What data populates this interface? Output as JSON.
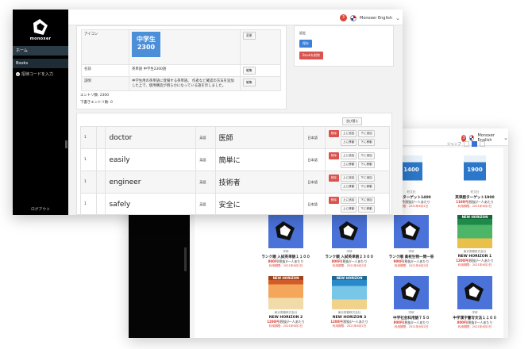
{
  "header": {
    "notification_count": "3",
    "user_name": "Monoxer English"
  },
  "sidebar": {
    "logo_text": "monoxer",
    "items": [
      {
        "label": "ホーム"
      },
      {
        "label": "Books"
      },
      {
        "label": "招待コードを入力"
      }
    ],
    "logout": "ログアウト"
  },
  "detail": {
    "icon_label": "アイコン",
    "icon_line1": "中学生",
    "icon_line2": "2300",
    "change_button": "変更",
    "name_label": "名前",
    "name_value": "英単語 中学生2300語",
    "edit_button": "編集",
    "desc_label": "説明",
    "desc_value": "中学生用の英単語に登場する英単語。 作者など確認の方法を追加した上で、使用構造が明らかになっている語を示しました。",
    "entries_count": "エントリ数: 2300",
    "entries_limit": "下書きエントリ数: 0"
  },
  "side_card": {
    "label": "設定",
    "save_button": "保存",
    "delete_button": "Bookを削除"
  },
  "words_table": {
    "reorder_button": "並び替え",
    "rows": [
      {
        "no": "1",
        "word": "doctor",
        "lang": "英語",
        "meaning": "医師",
        "lang2": "日本語"
      },
      {
        "no": "1",
        "word": "easily",
        "lang": "英語",
        "meaning": "簡単に",
        "lang2": "日本語"
      },
      {
        "no": "1",
        "word": "engineer",
        "lang": "英語",
        "meaning": "技術者",
        "lang2": "日本語"
      },
      {
        "no": "1",
        "word": "safely",
        "lang": "英語",
        "meaning": "安全に",
        "lang2": "日本語"
      }
    ],
    "actions": {
      "delete": "削除",
      "add_above": "上に追加",
      "add_below": "下に追加",
      "move_up": "上に移動",
      "move_down": "下に移動"
    }
  },
  "back_window": {
    "header": {
      "notification_count": "3",
      "user_name": "Monoxer English"
    },
    "pager_label": "ジャンプ",
    "books": [
      {
        "publisher": "旺文社",
        "title": "英単語ターゲット1400",
        "price": "1100円",
        "note": "(税抜)/一人あたり",
        "date": "利用期限：2021年6月2日",
        "cover_text": "1400"
      },
      {
        "publisher": "旺文社",
        "title": "英単語ターゲット1900",
        "price": "1100円",
        "note": "(税抜)/一人あたり",
        "date": "利用期限：2021年6月2日",
        "cover_text": "1900"
      },
      {
        "publisher": "学研",
        "title": "ランク順 入試英単語１１００",
        "price": "800円",
        "note": "(税抜)/一人あたり",
        "date": "利用期限：2021年6月2日"
      },
      {
        "publisher": "学研",
        "title": "ランク順 入試英単語２３００",
        "price": "800円",
        "note": "(税抜)/一人あたり",
        "date": "利用期限：2021年6月2日"
      },
      {
        "publisher": "学研",
        "title": "ランク順 高校生物一問一答",
        "price": "900円",
        "note": "(税抜)/一人あたり",
        "date": "利用期限：2021年6月2日"
      },
      {
        "publisher": "東京書籍株式会社",
        "title": "NEW HORIZON 1",
        "price": "1200円",
        "note": "(税抜)/一人あたり",
        "date": "利用期限：2021年6月2日",
        "cover_text": "NEW HORIZON"
      },
      {
        "publisher": "東京書籍株式会社",
        "title": "NEW HORIZON 2",
        "price": "1200円",
        "note": "(税抜)/一人あたり",
        "date": "利用期限：2021年6月2日",
        "cover_text": "NEW HORIZON"
      },
      {
        "publisher": "東京書籍株式会社",
        "title": "NEW HORIZON 3",
        "price": "1200円",
        "note": "(税抜)/一人あたり",
        "date": "利用期限：2021年6月2日",
        "cover_text": "NEW HORIZON"
      },
      {
        "publisher": "学研",
        "title": "中学社会科用語７５０",
        "price": "800円",
        "note": "(税抜)/一人あたり",
        "date": "利用期限：2021年6月2日"
      },
      {
        "publisher": "学研",
        "title": "中学漢字書写文法１１００",
        "price": "800円",
        "note": "(税抜)/一人あたり",
        "date": "利用期限：2021年6月2日"
      }
    ]
  },
  "colors": {
    "primary": "#3b7fd9",
    "danger": "#d9534f",
    "sidebar_bg": "#000000",
    "book_cover_blue": "#4a72d9"
  }
}
